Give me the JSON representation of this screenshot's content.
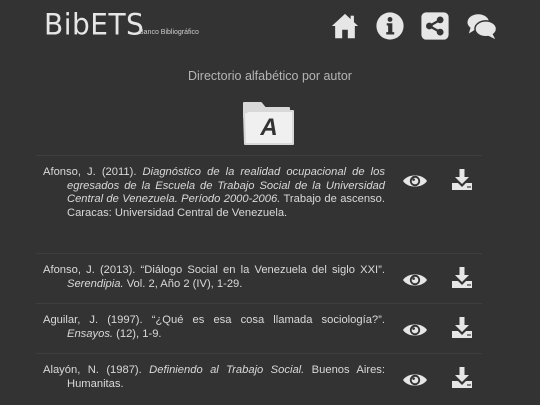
{
  "header": {
    "logo": "BibETS",
    "logo_subtitle": "Banco Bibliográfico",
    "nav": [
      {
        "icon": "home-icon"
      },
      {
        "icon": "info-icon"
      },
      {
        "icon": "share-icon"
      },
      {
        "icon": "chat-icon"
      }
    ]
  },
  "page": {
    "subtitle": "Directorio alfabético por autor",
    "letter": "A"
  },
  "entries": [
    {
      "plain1": "Afonso, J. (2011). ",
      "italic": "Diagnóstico de la realidad ocupacional de los egresados de la Escuela de Trabajo Social de la Universidad Central de Venezuela. Período 2000-2006.",
      "plain2": " Trabajo de ascenso. Caracas: Universidad Central de Venezuela."
    },
    {
      "plain1": "Afonso, J. (2013). “Diálogo Social en la Venezuela del siglo XXI”. ",
      "italic": "Serendipia.",
      "plain2": " Vol. 2, Año 2 (IV), 1-29."
    },
    {
      "plain1": "Aguilar, J. (1997). “¿Qué es esa cosa llamada sociología?”. ",
      "italic": "Ensayos.",
      "plain2": " (12), 1-9."
    },
    {
      "plain1": "Alayón, N. (1987). ",
      "italic": "Definiendo al Trabajo Social.",
      "plain2": " Buenos Aires: Humanitas."
    }
  ],
  "colors": {
    "background": "#333333",
    "icon": "#e6e6e6",
    "text": "#d9d9d9"
  }
}
